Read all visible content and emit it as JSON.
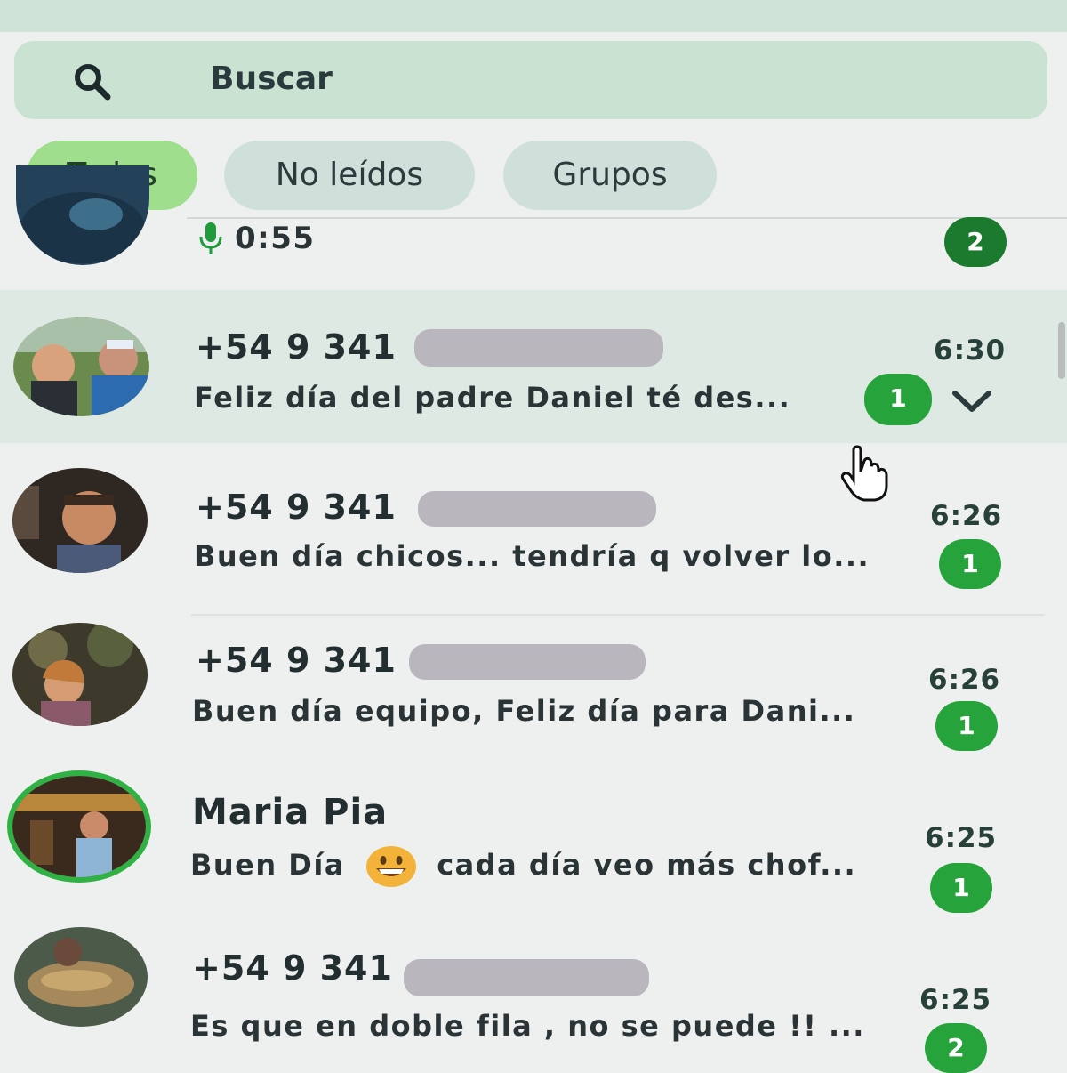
{
  "search": {
    "icon": "search-icon",
    "placeholder": "Buscar"
  },
  "filters": [
    {
      "label": "Todos",
      "active": true
    },
    {
      "label": "No leídos",
      "active": false
    },
    {
      "label": "Grupos",
      "active": false
    }
  ],
  "chats": [
    {
      "name": "",
      "message": "0:55",
      "message_icon": "microphone-icon",
      "time": "",
      "unread": "2"
    },
    {
      "name": "+54 9 341",
      "name_redacted": true,
      "message": "Feliz día del padre Daniel té des...",
      "time": "6:30",
      "unread": "1",
      "hover_icon": "chevron-down-icon"
    },
    {
      "name": "+54 9 341",
      "name_redacted": true,
      "message": "Buen día chicos... tendría q volver lo...",
      "time": "6:26",
      "unread": "1"
    },
    {
      "name": "+54 9 341",
      "name_redacted": true,
      "message": "Buen día equipo, Feliz día para Dani...",
      "time": "6:26",
      "unread": "1"
    },
    {
      "name": "Maria Pia",
      "message_before": "Buen Día",
      "message_emoji": "grinning-face-emoji",
      "message_after": "cada día veo más chof...",
      "time": "6:25",
      "unread": "1",
      "status_ring": true
    },
    {
      "name": "+54 9 341",
      "name_redacted": true,
      "message": "Es que en doble fila , no se puede !! ...",
      "time": "6:25",
      "unread": "2"
    }
  ],
  "colors": {
    "accent_green": "#27a33c",
    "active_chip": "#9fde8c",
    "search_bg": "#c9e2d2"
  }
}
